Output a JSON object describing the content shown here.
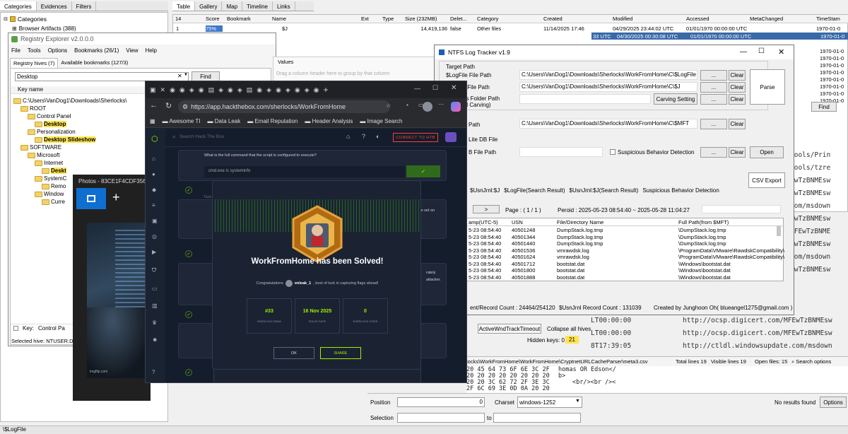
{
  "timeline_explorer": {
    "left_tabs": [
      "Categories",
      "Evidences",
      "Filters"
    ],
    "categories_header": "Categories",
    "category_item": "Browser Artifacts (388)",
    "top_tabs": [
      "Table",
      "Gallery",
      "Map",
      "Timeline",
      "Links"
    ],
    "columns": [
      "Score",
      "Bookmark",
      "Name",
      "Ext",
      "Type",
      "Size (232MB)",
      "Delet...",
      "Category",
      "Created",
      "Modified",
      "Accessed",
      "MetaChanged",
      "TimeStam"
    ],
    "row_count": "14",
    "row1": {
      "num": "1",
      "score": "75%",
      "name": "$J",
      "size": "14,419,136",
      "deleted": "false",
      "category": "Other files",
      "created": "11/14/2025 17:46",
      "created_tail": "33 UTC",
      "modified": "04/29/2025 23:44:02 UTC",
      "accessed": "01/01/1970 00:00:00 UTC",
      "meta": "1970-01-0"
    },
    "row2": {
      "created_tail": "33 UTC",
      "modified": "04/30/2025 00:30:08 UTC",
      "accessed": "01/01/1970 00:00:00 UTC",
      "meta": "1970-01-0"
    },
    "right_dates": [
      "1970-01-0",
      "1970-01-0",
      "1970-01-0",
      "1970-01-0",
      "1970-01-0",
      "1970-01-0",
      "1970-01-0",
      "1970-01-0"
    ],
    "find_label": "Find",
    "hex_urls": [
      "tools/Prin",
      "tools/tzre",
      "EwTzBNMEsw",
      "EwTzBNMEsw",
      "com/msdown",
      "EwTzBNMEsw",
      "MFEwTzBNME",
      "EwTzBNMEsw",
      "com/msdown",
      "EwTzBNMEsw"
    ],
    "bottom_urls": [
      {
        "time": "LT00:00:00",
        "url": "http://ocsp.digicert.com/MFEwTzBNMEsw"
      },
      {
        "time": "LT00:00:00",
        "url": "http://ocsp.digicert.com/MFEwTzBNMEsw"
      },
      {
        "time": "8T17:39:05",
        "url": "http://ctldl.windowsupdate.com/msdown"
      }
    ],
    "path_line": "locks\\WorkFromHome\\WorkFromHome\\CryptnetURLCacheParser\\meta3.csv",
    "total_lines": "Total lines 19",
    "visible_lines": "Visible lines 19",
    "open_files": "Open files: 15",
    "search_options": "Search options",
    "hex_rows": [
      {
        "hex": "20 45 64 73 6F 6E 3C 2F",
        "txt": "homas OR Edson</"
      },
      {
        "hex": "20 20 20 20 20 20 20 20",
        "txt": "b>"
      },
      {
        "hex": "20 20 3C 62 72 2F 3E 3C",
        "txt": "  <br/><br /><"
      },
      {
        "hex": "2F 6C 69 3E 0D 0A 20 20",
        "txt": ""
      }
    ],
    "position_label": "Position",
    "position_value": "0",
    "selection_label": "Selection",
    "to_label": "to",
    "charset_label": "Charset",
    "charset_value": "windows-1252",
    "no_results": "No results found",
    "options_label": "Options",
    "status_bar": "\\$LogFile"
  },
  "registry_explorer": {
    "title": "Registry Explorer v2.0.0.0",
    "menu": [
      "File",
      "Tools",
      "Options",
      "Bookmarks (26/1)",
      "View",
      "Help"
    ],
    "tabs": [
      "Registry hives (7)",
      "Available bookmarks (127/3)"
    ],
    "values_tab": "Values",
    "search_value": "Desktop",
    "find_button": "Find",
    "drag_hint": "Drag a column header here to group by that column",
    "key_name_header": "Key name",
    "tree": [
      {
        "label": "C:\\Users\\VanDog1\\Downloads\\Sherlocks\\",
        "indent": 0,
        "hl": false
      },
      {
        "label": "ROOT",
        "indent": 1,
        "hl": false
      },
      {
        "label": "Control Panel",
        "indent": 2,
        "hl": false
      },
      {
        "label": "Desktop",
        "indent": 3,
        "hl": true
      },
      {
        "label": "Personalization",
        "indent": 2,
        "hl": false
      },
      {
        "label": "Desktop Slideshow",
        "indent": 3,
        "hl": true
      },
      {
        "label": "SOFTWARE",
        "indent": 1,
        "hl": false
      },
      {
        "label": "Microsoft",
        "indent": 2,
        "hl": false
      },
      {
        "label": "Internet",
        "indent": 3,
        "hl": false
      },
      {
        "label": "Deskt",
        "indent": 4,
        "hl": true
      },
      {
        "label": "SystemC",
        "indent": 3,
        "hl": false
      },
      {
        "label": "Remo",
        "indent": 4,
        "hl": false
      },
      {
        "label": "Window",
        "indent": 3,
        "hl": false
      },
      {
        "label": "Curre",
        "indent": 4,
        "hl": false
      }
    ],
    "footer_key": "Key:",
    "footer_value": "Control Pa",
    "selected_hive": "Selected hive: NTUSER.DAT"
  },
  "photos": {
    "title": "Photos - 83CE1F4CDF3562A",
    "new_label": "+",
    "credit": "imgflip.com"
  },
  "ntfs": {
    "title": "NTFS Log Tracker v1.9",
    "target_path": "Target Path",
    "logfile_label": "$LogFile File Path",
    "logfile_value": "C:\\Users\\VanDog1\\Downloads\\Sherlocks\\WorkFromHome\\C\\$LogFile",
    "j_label": "J File Path",
    "j_value": "C:\\Users\\VanDog1\\Downloads\\Sherlocks\\WorkFromHome\\C\\$J",
    "folder_label": "es Folder Path",
    "carving_label": "rd Carving)",
    "carving_button": "Carving Setting",
    "mft_label": "Path",
    "mft_value": "C:\\Users\\VanDog1\\Downloads\\Sherlocks\\WorkFromHome\\C\\$MFT",
    "db_label": "Lite DB File",
    "db_path_label": "B File Path",
    "suspicious_label": "Suspicious Behavior Detection",
    "dots": "...",
    "clear": "Clear",
    "parse": "Parse",
    "open": "Open",
    "csv_export": "CSV Export",
    "tabs": [
      "$UsnJrnl:$J",
      "$LogFile(Search Result)",
      "$UsnJrnl:$J(Search Result)",
      "Suspicious Behavior Detection"
    ],
    "nav_next": ">",
    "page": "Page : ( 1 / 1 )",
    "period": "Peroid : 2025-05-23 08:54:40 ~ 2025-05-28 11:04:27",
    "grid_headers": [
      "amp(UTC-5)",
      "USN",
      "File/Directory Name",
      "Full Path(from $MFT)"
    ],
    "rows": [
      {
        "ts": "5-23 08:54:40",
        "usn": "40501248",
        "name": "DumpStack.log.tmp",
        "path": "\\DumpStack.log.tmp"
      },
      {
        "ts": "5-23 08:54:40",
        "usn": "40501344",
        "name": "DumpStack.log.tmp",
        "path": "\\DumpStack.log.tmp"
      },
      {
        "ts": "5-23 08:54:40",
        "usn": "40501440",
        "name": "DumpStack.log.tmp",
        "path": "\\DumpStack.log.tmp"
      },
      {
        "ts": "5-23 08:54:40",
        "usn": "40501536",
        "name": "vmrawdsk.log",
        "path": "\\ProgramData\\VMware\\RawdskCompatibility\\"
      },
      {
        "ts": "5-23 08:54:40",
        "usn": "40501624",
        "name": "vmrawdsk.log",
        "path": "\\ProgramData\\VMware\\RawdskCompatibility\\"
      },
      {
        "ts": "5-23 08:54:40",
        "usn": "40501712",
        "name": "bootstat.dat",
        "path": "\\Windows\\bootstat.dat"
      },
      {
        "ts": "5-23 08:54:40",
        "usn": "40501800",
        "name": "bootstat.dat",
        "path": "\\Windows\\bootstat.dat"
      },
      {
        "ts": "5-23 08:54:40",
        "usn": "40501888",
        "name": "bootstat.dat",
        "path": "\\Windows\\bootstat.dat"
      }
    ],
    "record_count": "ent/Record Count : 24464/254120",
    "usn_count": "$UsnJrnl Record Count : 131039",
    "created_by": "Created by Junghoon Oh( blueangel1275@gmail.com )",
    "active_wnd": "ActiveWndTrackTimeout",
    "collapse": "Collapse all hives",
    "hidden_keys_label": "Hidden keys: 0",
    "hidden_keys_value": "21"
  },
  "browser": {
    "url": "https://app.hackthebox.com/sherlocks/WorkFromHome",
    "bookmarks": [
      "Awesome TI",
      "Data Leak",
      "Email Reputation",
      "Header Analysis",
      "Image Search"
    ],
    "search_placeholder": "Search Hack The Box",
    "connect": "CONNECT TO HTB",
    "question": "What is the full command that the script is configured to execute?",
    "answer": "cmd.exe /c systeminfo",
    "task_label": "Task",
    "modal_title": "WorkFromHome has been Solved!",
    "congrats_prefix": "Congratulations",
    "username": "enleak_1",
    "congrats_suffix": ", best of luck in capturing flags ahead!",
    "stats": [
      {
        "value": "#33",
        "label": "SHERLOCK RANK"
      },
      {
        "value": "16 Nov 2025",
        "label": "SOLVE DATE"
      },
      {
        "value": "0",
        "label": "SHERLOCK STATE"
      }
    ],
    "ok": "OK",
    "share": "SHARE",
    "snippet_right1": "ute set on",
    "snippet_right2": "rately",
    "snippet_right3": "attacker."
  },
  "colors": {
    "htb_green": "#9fef00",
    "win_blue": "#0f6fd1",
    "highlight": "#ffe44d"
  }
}
